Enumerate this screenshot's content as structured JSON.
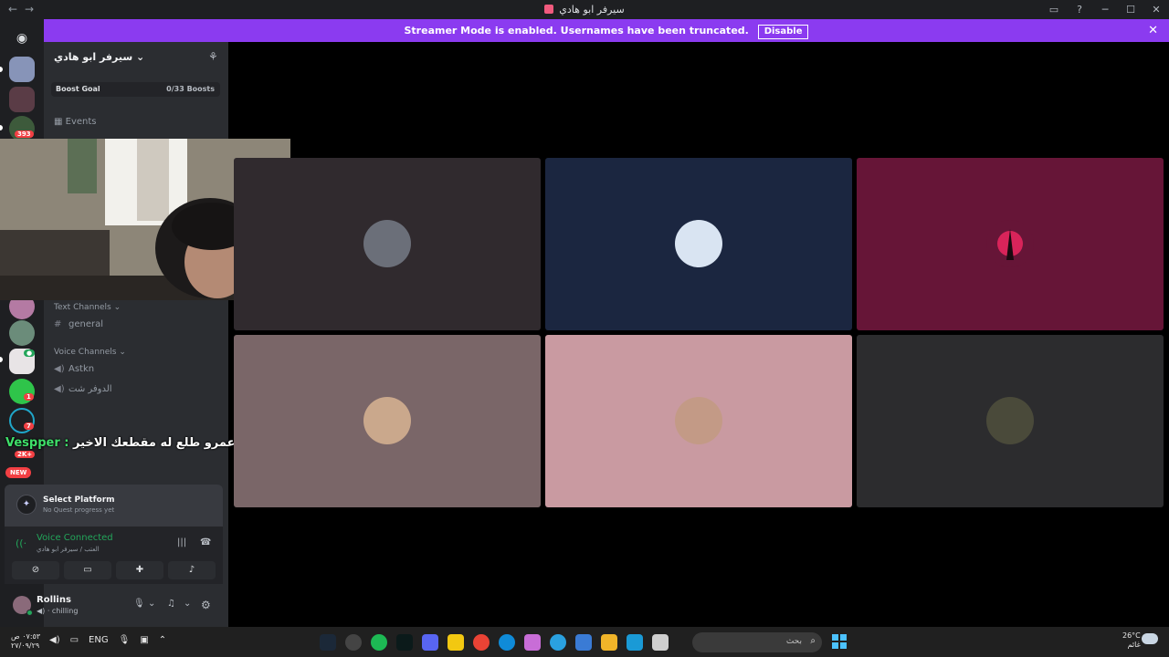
{
  "window": {
    "title": "سيرفر ابو هادي",
    "back": "←",
    "forward": "→",
    "controls": [
      "▭",
      "?",
      "─",
      "☐",
      "✕"
    ]
  },
  "banner": {
    "text": "Streamer Mode is enabled. Usernames have been truncated.",
    "button": "Disable",
    "close": "✕"
  },
  "guilds": {
    "badges": [
      "393",
      "1",
      "1",
      "7",
      "2K+",
      "NEW"
    ]
  },
  "sidebar": {
    "server_name": "سيرفر ابو هادي",
    "boost_label": "Boost Goal",
    "boost_value": "0/33 Boosts",
    "events": "Events",
    "text_channels": "Text Channels",
    "channel_general": "general",
    "voice_channels": "Voice Channels",
    "voice_1": "Astkn",
    "voice_2": "الدوفر شت"
  },
  "overlay": {
    "who": "Vespper :",
    "message": "ترا عمرو طلع له مقطعك الاخير"
  },
  "quest": {
    "title": "Select Platform",
    "sub": "No Quest progress yet"
  },
  "voice": {
    "title": "Voice Connected",
    "sub": "العتب / سيرفر ابو هادي"
  },
  "user": {
    "name": "Rollins",
    "status": "chilling"
  },
  "tiles": [
    {
      "bg": "#302a2e"
    },
    {
      "bg": "#1b2640"
    },
    {
      "bg": "#661537"
    },
    {
      "bg": "#7a6668"
    },
    {
      "bg": "#c99aa1"
    },
    {
      "bg": "#2c2c2e"
    }
  ],
  "taskbar": {
    "time": "٠٧:٥٣ ص",
    "date": "٢٧/٠٩/٢٩",
    "lang": "ENG",
    "search_placeholder": "بحث",
    "temp": "26°C",
    "weather": "غائم"
  }
}
